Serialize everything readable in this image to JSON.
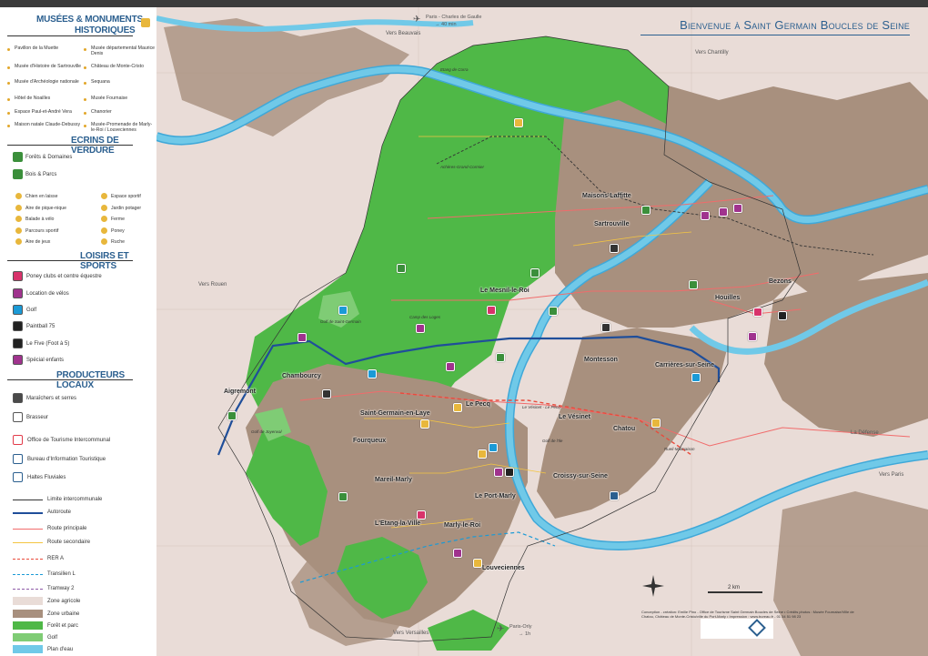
{
  "title": "Bienvenue à Saint Germain Boucles de Seine",
  "legend": {
    "musees_title_1": "Musées & monuments",
    "musees_title_2": "historiques",
    "musees": [
      {
        "label": "Pavillon de la Muette"
      },
      {
        "label": "Musée départemental Maurice Denis"
      },
      {
        "label": "Musée d'Histoire de Sartrouville"
      },
      {
        "label": "Château de Monte-Cristo"
      },
      {
        "label": "Musée d'Archéologie nationale"
      },
      {
        "label": "Sequana"
      },
      {
        "label": "Hôtel de Noailles"
      },
      {
        "label": "Musée Fournaise"
      },
      {
        "label": "Espace Paul-et-André Vera"
      },
      {
        "label": "Chanorier"
      },
      {
        "label": "Maison natale Claude-Debussy"
      },
      {
        "label": "Musée-Promenade de Marly-le-Roi / Louveciennes"
      }
    ],
    "ecrins_title": "Ecrins de verdure",
    "ecrins": [
      {
        "label": "Forêts & Domaines"
      },
      {
        "label": "Bois & Parcs"
      }
    ],
    "activities": [
      {
        "label": "Chien en laisse",
        "icon": "dog-icon"
      },
      {
        "label": "Espace sportif",
        "icon": "sport-icon"
      },
      {
        "label": "Aire de pique-nique",
        "icon": "picnic-icon"
      },
      {
        "label": "Jardin potager",
        "icon": "garden-icon"
      },
      {
        "label": "Balade à vélo",
        "icon": "bike-icon"
      },
      {
        "label": "Ferme",
        "icon": "farm-icon"
      },
      {
        "label": "Parcours sportif",
        "icon": "running-icon"
      },
      {
        "label": "Poney",
        "icon": "pony-icon"
      },
      {
        "label": "Aire de jeux",
        "icon": "playground-icon"
      },
      {
        "label": "Ruche",
        "icon": "beehive-icon"
      }
    ],
    "loisirs_title": "Loisirs et sports",
    "loisirs": [
      {
        "label": "Poney clubs et centre équestre",
        "color": "#d8336b"
      },
      {
        "label": "Location de vélos",
        "color": "#a0338e"
      },
      {
        "label": "Golf",
        "color": "#1b9ad6"
      },
      {
        "label": "Paintball 75",
        "color": "#222222"
      },
      {
        "label": "Le Five (Foot à 5)",
        "color": "#222222"
      },
      {
        "label": "Spécial enfants",
        "color": "#a0338e"
      }
    ],
    "producteurs_title": "Producteurs locaux",
    "producteurs": [
      {
        "label": "Maraîchers et serres",
        "color": "#4a4a4a"
      },
      {
        "label": "Brasseur",
        "color": "#ffffff"
      }
    ],
    "offices": [
      {
        "label": "Office de Tourisme Intercommunal"
      },
      {
        "label": "Bureau d'Information Touristique"
      },
      {
        "label": "Haltes Fluviales"
      }
    ],
    "lines": [
      {
        "label": "Limite intercommunale"
      },
      {
        "label": "Autoroute"
      },
      {
        "label": "Route principale"
      },
      {
        "label": "Route secondaire"
      },
      {
        "label": "RER A"
      },
      {
        "label": "Transilien L"
      },
      {
        "label": "Tramway 2"
      }
    ],
    "zones": [
      {
        "label": "Zone agricole",
        "color": "#e9dcd7"
      },
      {
        "label": "Zone urbaine",
        "color": "#a8907e"
      },
      {
        "label": "Forêt et parc",
        "color": "#4fb847"
      },
      {
        "label": "Golf",
        "color": "#7fcc75"
      },
      {
        "label": "Plan d'eau",
        "color": "#70c9e8"
      }
    ]
  },
  "map": {
    "towns": [
      {
        "label": "Maisons-Laffitte"
      },
      {
        "label": "Sartrouville"
      },
      {
        "label": "Le Mesnil-le-Roi"
      },
      {
        "label": "Bezons"
      },
      {
        "label": "Houilles"
      },
      {
        "label": "Montesson"
      },
      {
        "label": "Carrières-sur-Seine"
      },
      {
        "label": "Chambourcy"
      },
      {
        "label": "Aigremont"
      },
      {
        "label": "Saint-Germain-en-Laye"
      },
      {
        "label": "Le Pecq"
      },
      {
        "label": "Le Vésinet"
      },
      {
        "label": "Chatou"
      },
      {
        "label": "Fourqueux"
      },
      {
        "label": "Mareil-Marly"
      },
      {
        "label": "Croissy-sur-Seine"
      },
      {
        "label": "Le Port-Marly"
      },
      {
        "label": "L'Etang-la-Ville"
      },
      {
        "label": "Marly-le-Roi"
      },
      {
        "label": "Louveciennes"
      }
    ],
    "directions": [
      {
        "label": "Vers Beauvais"
      },
      {
        "label": "Vers Chantilly"
      },
      {
        "label": "Vers Rouen"
      },
      {
        "label": "Vers Paris"
      },
      {
        "label": "Vers Versailles"
      },
      {
        "label": "La Défense"
      }
    ],
    "airports": [
      {
        "label": "Paris - Charles de Gaulle",
        "time": "40 min"
      },
      {
        "label": "Paris-Orly",
        "time": "1h"
      }
    ],
    "small_labels": [
      {
        "label": "Etang de Corra"
      },
      {
        "label": "Achères-Grand-Cormier"
      },
      {
        "label": "Golf de Saint-Germain"
      },
      {
        "label": "Camp des Loges"
      },
      {
        "label": "Golf de Joyenval"
      },
      {
        "label": "Le Vésinet - Le Pecq"
      },
      {
        "label": "Rueil-Malmaison"
      },
      {
        "label": "Golf de l'Ile"
      }
    ],
    "scale_label": "2 km"
  },
  "credits": "Conception - création: Emilie Pino - Office de Tourisme Saint Germain Boucles de Seine • Crédits photos : Musée Fournaise/Ville de Chatou, Château de Monte-Cristo/ville du Port-Marly • Impression : www.bureau.fr - 01 34 51 98 23"
}
